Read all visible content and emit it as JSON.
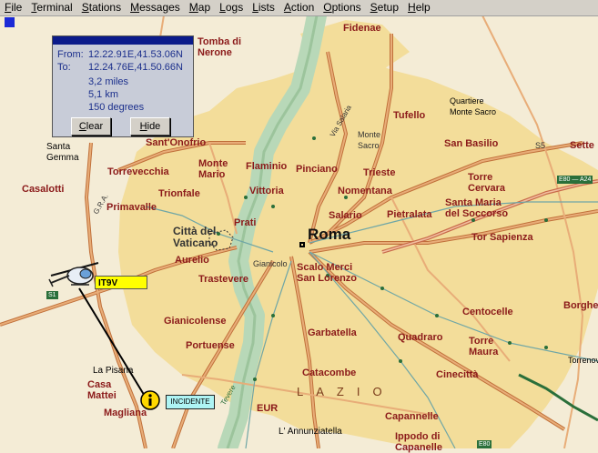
{
  "menubar": {
    "items": [
      "File",
      "Terminal",
      "Stations",
      "Messages",
      "Map",
      "Logs",
      "Lists",
      "Action",
      "Options",
      "Setup",
      "Help"
    ]
  },
  "measure_panel": {
    "from_label": "From:",
    "from_value": "12.22.91E,41.53.06N",
    "to_label": "To:",
    "to_value": "12.24.76E,41.50.66N",
    "miles": "3,2 miles",
    "km": "5,1 km",
    "bearing": "150 degrees",
    "clear_label": "Clear",
    "hide_label": "Hide"
  },
  "markers": {
    "callsign": "IT9V",
    "incident": "INCIDENTE"
  },
  "map": {
    "colors": {
      "background": "#f4ecd6",
      "urban": "#f3dd9a",
      "river_band": "#b8d8b8",
      "road": "#e8ad78",
      "road_border": "#c0703a",
      "highway": "#c86a4a",
      "rail": "#6fa6a6",
      "label": "#8b1a1a"
    },
    "places": {
      "tomba_di_nerone": "Tomba di\nNerone",
      "fidenae": "Fidenae",
      "quartiere": "Quartiere\nMonte Sacro",
      "tufello": "Tufello",
      "monte_sacro": "Monte\nSacro",
      "via_salaria": "Via Salaria",
      "san_basilio": "San Basilio",
      "settecamini": "Sette",
      "santa_gemma": "Santa\nGemma",
      "sant_onofrio": "Sant'Onofrio",
      "casalotti": "Casalotti",
      "torrevecchia": "Torrevecchia",
      "monte_mario": "Monte\nMario",
      "flaminio": "Flaminio",
      "pinciano": "Pinciano",
      "trieste": "Trieste",
      "torre_cervara": "Torre\nCervara",
      "trionfale": "Trionfale",
      "primavalle": "Primavalle",
      "vittoria": "Vittoria",
      "nomentana": "Nomentana",
      "santa_maria": "Santa Maria\ndel Soccorso",
      "salario": "Salario",
      "pietralata": "Pietralata",
      "prati": "Prati",
      "citta_vaticano": "Città del\nVaticano",
      "roma": "Roma",
      "tor_sapienza": "Tor Sapienza",
      "aurelio": "Aurelio",
      "gianicolo": "Gianicolo",
      "scalo_merci": "Scalo Merci\nSan Lorenzo",
      "trastevere": "Trastevere",
      "borghese": "Borghes",
      "centocelle": "Centocelle",
      "gianicolense": "Gianicolense",
      "garbatella": "Garbatella",
      "quadraro": "Quadraro",
      "portuense": "Portuense",
      "torre_maura": "Torre\nMaura",
      "torrenova": "Torrenova",
      "la_pisana": "La Pisana",
      "catacombe": "Catacombe",
      "cinecitta": "Cinecittà",
      "casa_mattei": "Casa\nMattei",
      "lazio": "LAZIO",
      "magliana": "Magliana",
      "eur": "EUR",
      "capannelle": "Capannelle",
      "annunziatella": "L' Annunziatella",
      "ippodromo": "Ippodo di\nCapanelle",
      "tevere": "Tevere",
      "gra": "G.R.A.",
      "s5": "S5",
      "e80_a24": "E80 — A24",
      "e80": "E80",
      "s1": "S1"
    }
  }
}
